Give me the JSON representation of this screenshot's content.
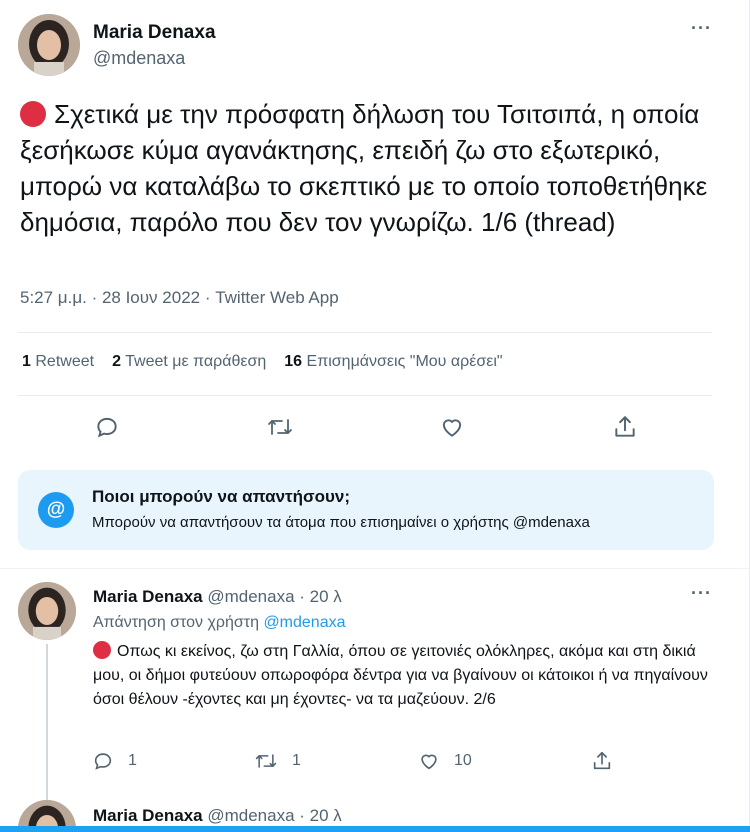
{
  "main_tweet": {
    "author_name": "Maria Denaxa",
    "author_handle": "@mdenaxa",
    "more_icon": "···",
    "text": "Σχετικά με την πρόσφατη δήλωση του Τσιτσιπά, η οποία  ξεσήκωσε κύμα αγανάκτησης, επειδή ζω στο εξωτερικό, μπορώ να καταλάβω το σκεπτικό με το οποίο τοποθετήθηκε δημόσια, παρόλο που δεν τον γνωρίζω. 1/6 (thread)",
    "timestamp": "5:27 μ.μ. · 28 Ιουν 2022 · Twitter Web App",
    "stats": {
      "retweets_count": "1",
      "retweets_label": "Retweet",
      "quotes_count": "2",
      "quotes_label": "Tweet με παράθεση",
      "likes_count": "16",
      "likes_label": "Επισημάνσεις \"Μου αρέσει\""
    },
    "actions": [
      "reply-icon",
      "retweet-icon",
      "like-icon",
      "share-icon"
    ]
  },
  "who_can_reply": {
    "icon": "@",
    "title": "Ποιοι μπορούν να απαντήσουν;",
    "subtitle": "Μπορούν να απαντήσουν τα άτομα που επισημαίνει ο χρήστης @mdenaxa"
  },
  "reply": {
    "author_name": "Maria Denaxa",
    "author_handle_time": "@mdenaxa · 20 λ",
    "more_icon": "···",
    "replying_to_prefix": "Απάντηση στον χρήστη",
    "replying_to_mention": "@mdenaxa",
    "text": "Οπως κι εκείνος, ζω στη Γαλλία, όπου σε γειτονιές ολόκληρες, ακόμα και στη δικιά μου, οι δήμοι φυτεύουν οπωροφόρα δέντρα για να βγαίνουν οι κάτοικοι ή να πηγαίνουν όσοι θέλουν -έχοντες και μη έχοντες- να τα μαζεύουν. 2/6",
    "reply_count": "1",
    "retweet_count": "1",
    "like_count": "10"
  },
  "reply2": {
    "author_name": "Maria Denaxa",
    "author_handle_time": "@mdenaxa · 20 λ"
  },
  "colors": {
    "accent": "#1d9bf0",
    "secondary_text": "#536471",
    "info_box_bg": "#e8f5fd",
    "red_circle": "#dd2e44"
  }
}
